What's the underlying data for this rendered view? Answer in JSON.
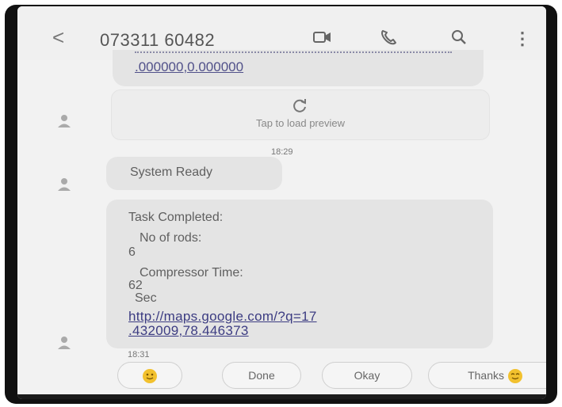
{
  "header": {
    "back_glyph": "<",
    "title": "073311 60482",
    "more_glyph": "⋮"
  },
  "messages": {
    "link_fragment": ".000000,0.000000",
    "preview_label": "Tap to load preview",
    "time_1": "18:29",
    "system_ready": "System Ready",
    "task": {
      "heading": "Task Completed:",
      "rods_label": "No of rods:",
      "rods_value": "6",
      "compressor_label": "Compressor Time:",
      "compressor_value": "62",
      "compressor_unit": "Sec",
      "map_link_line1": "http://maps.google.com/?q=17",
      "map_link_line2": ".432009,78.446373"
    },
    "time_2": "18:31"
  },
  "quick_replies": {
    "done": "Done",
    "okay": "Okay",
    "thanks": "Thanks"
  },
  "colors": {
    "screen_bg": "#f2f2f2",
    "bubble": "#e4e4e4",
    "link": "#3c3c82",
    "emoji": "#f2c12e"
  },
  "icons": [
    "back-icon",
    "video-call-icon",
    "phone-call-icon",
    "search-icon",
    "more-options-icon",
    "contact-avatar-icon",
    "refresh-icon",
    "smiley-emoji-icon"
  ]
}
